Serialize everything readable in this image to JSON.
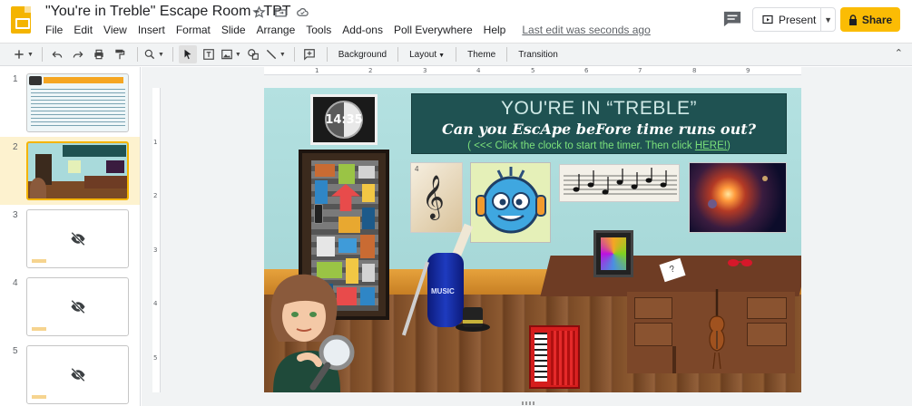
{
  "document": {
    "title": "\"You're in Treble\" Escape Room - TPT"
  },
  "menu": {
    "items": [
      "File",
      "Edit",
      "View",
      "Insert",
      "Format",
      "Slide",
      "Arrange",
      "Tools",
      "Add-ons",
      "Poll Everywhere",
      "Help"
    ],
    "last_edit": "Last edit was seconds ago"
  },
  "header": {
    "present_label": "Present",
    "share_label": "Share"
  },
  "toolbar": {
    "background_label": "Background",
    "layout_label": "Layout",
    "theme_label": "Theme",
    "transition_label": "Transition"
  },
  "ruler": {
    "top_ticks": [
      "1",
      "2",
      "3",
      "4",
      "5",
      "6",
      "7",
      "8",
      "9"
    ],
    "left_ticks": [
      "1",
      "2",
      "3",
      "4",
      "5"
    ]
  },
  "filmstrip": {
    "slides": [
      {
        "number": "1",
        "hidden": false,
        "selected": false
      },
      {
        "number": "2",
        "hidden": false,
        "selected": true
      },
      {
        "number": "3",
        "hidden": true,
        "selected": false
      },
      {
        "number": "4",
        "hidden": true,
        "selected": false
      },
      {
        "number": "5",
        "hidden": true,
        "selected": false
      }
    ]
  },
  "slide": {
    "clock_text": "14:35",
    "title": "YOU'RE IN “TREBLE”",
    "subtitle": "Can you EscApe beFore time runs out?",
    "instruction": "( <<< Click the clock to start the timer.  Then click ",
    "instruction_link": "HERE!",
    "instruction_end": ")",
    "notes_number": "4",
    "vase_label": "MUSIC",
    "card_mark": "?"
  },
  "colors": {
    "accent": "#fbbc04",
    "title_panel": "#1f5252",
    "instruction_green": "#7be07b",
    "wall": "#a9dadb"
  }
}
